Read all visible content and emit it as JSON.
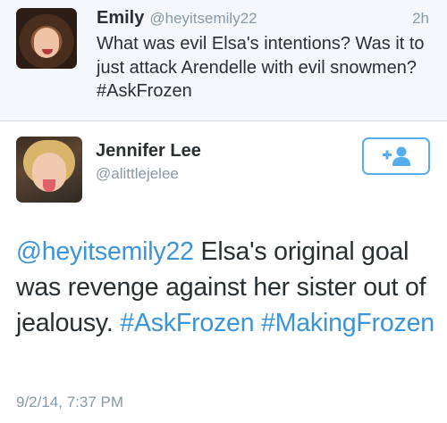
{
  "reply_tweet": {
    "author_name": "Emily",
    "author_handle": "@heyitsemily22",
    "time_ago": "2h",
    "text": "What was evil Elsa's intentions? Was it to just attack Arendelle with evil snowmen? #AskFrozen"
  },
  "main_tweet": {
    "author_name": "Jennifer Lee",
    "author_handle": "@alittlejelee",
    "follow_icon": "add-user-icon",
    "mention": "@heyitsemily22",
    "text": " Elsa's original goal was revenge against her sister out of jealousy. ",
    "hashtag_1": "#AskFrozen",
    "separator": " ",
    "hashtag_2": "#MakingFrozen",
    "timestamp": "9/2/14, 7:37 PM"
  },
  "colors": {
    "link": "#3b94d9",
    "follow_button": "#55acee",
    "muted_text": "#8899a6",
    "top_background": "#f5f8fa"
  }
}
